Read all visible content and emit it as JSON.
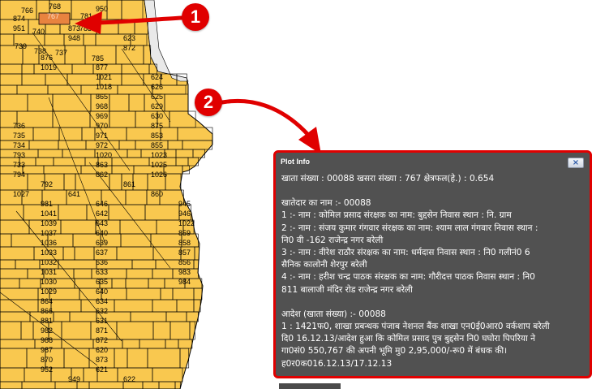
{
  "map": {
    "parcel_labels": [
      "766",
      "768",
      "767",
      "781",
      "740",
      "783",
      "739",
      "738",
      "737",
      "785",
      "736",
      "735",
      "734",
      "793",
      "733",
      "794",
      "792",
      "641",
      "646",
      "642",
      "643",
      "640",
      "639",
      "637",
      "636",
      "633",
      "635",
      "640",
      "634",
      "632",
      "631",
      "871",
      "872",
      "620",
      "873",
      "621",
      "622",
      "874",
      "873",
      "623",
      "876",
      "877",
      "624",
      "626",
      "625",
      "629",
      "630",
      "875",
      "853",
      "855",
      "1023",
      "1025",
      "1026",
      "1027",
      "981",
      "1041",
      "1039",
      "1037",
      "1036",
      "1033",
      "1032",
      "1031",
      "1030",
      "1029",
      "864",
      "866",
      "881",
      "982",
      "988",
      "987",
      "870",
      "952",
      "949",
      "950",
      "951",
      "948",
      "872",
      "1019",
      "1021",
      "1018",
      "865",
      "968",
      "969",
      "970",
      "971",
      "972",
      "1020",
      "863",
      "862",
      "861",
      "860",
      "945",
      "946",
      "1022",
      "859",
      "858",
      "857",
      "856",
      "983",
      "984"
    ]
  },
  "markers": [
    "1",
    "2"
  ],
  "plot_info": {
    "title": "Plot Info",
    "close_label": "×",
    "lines": [
      "खाता संख्या : 00088 खसरा संख्या : 767 क्षेत्रफल(हे.) : 0.654",
      "",
      "खातेदार का नाम :- 00088",
      "1 :- नाम : कोमिल प्रसाद संरक्षक का नाम: बुद्दसेन निवास स्थान : नि. ग्राम",
      "2 :- नाम : संजय कुमार गंगवार संरक्षक का नाम: श्याम लाल गंगवार निवास स्थान :",
      "नि0 वी -162 राजेन्द्र नगर बरेली",
      "3 :- नाम : वीरेश राठौर संरक्षक का नाम: धर्मदास निवास स्थान : नि0 गलीनं0 6",
      "सैनिक कालोनी शेरपुर बरेली",
      "4 :- नाम : हरीश चन्द्र पाठक संरक्षक का नाम: गौरीदत्त पाठक निवास स्थान : नि0",
      "811 बालाजी मंदिर रोड राजेन्द्र नगर बरेली",
      "",
      "आदेश (खाता संख्या) :- 00088",
      "1 : 1421फ0, शाखा प्रबन्धक पंजाब नेशनल बैंक शाखा एन0ई0आर0 वर्कशाप बरेली",
      "दि0 16.12.13/आदेश हुआ कि कोमिल प्रसाद पुत्र बुद्दसेन नि0 घघोरा पिपरिया ने",
      "गा0सं0 550,767 की अपनी भूमि मु0 2,95,000/-रू0 में बंधक की।",
      "ह0र0क016.12.13/17.12.13"
    ]
  },
  "colors": {
    "parcel_fill": "#f9c84f",
    "parcel_stroke": "#000000",
    "selected_parcel": "#e8833f",
    "annotation_red": "#e00000",
    "panel_bg": "#515151"
  }
}
